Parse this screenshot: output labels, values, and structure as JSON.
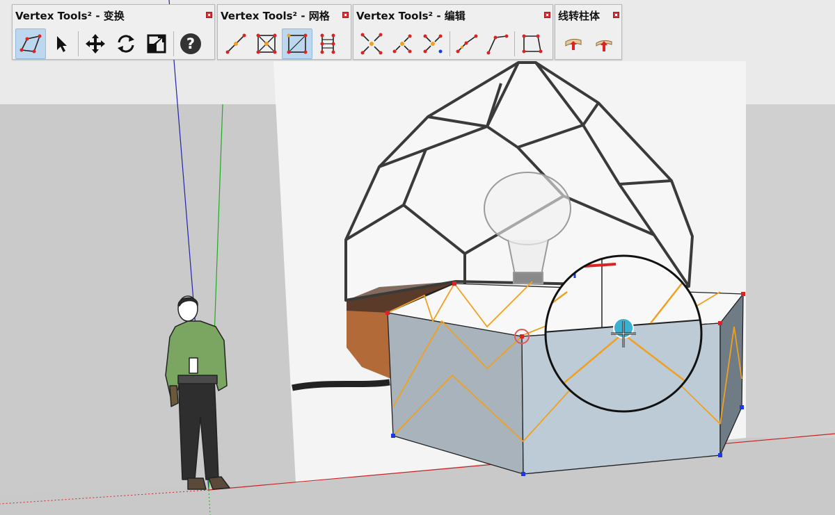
{
  "toolbars": [
    {
      "title": "Vertex Tools² - 变换",
      "tools": [
        "polygon-select-icon",
        "pointer-arrow-icon",
        "move-arrows-icon",
        "rotate-icon",
        "scale-icon",
        "help-icon"
      ]
    },
    {
      "title": "Vertex Tools² - 网格",
      "tools": [
        "line-grid-icon",
        "square-cross-grid-icon",
        "square-corner-grid-icon",
        "ladder-grid-icon"
      ]
    },
    {
      "title": "Vertex Tools² - 编辑",
      "tools": [
        "merge-diagonal-icon",
        "merge-arrows-icon",
        "merge-x-icon",
        "extend-line-icon",
        "corner-line-icon",
        "square-vertex-icon"
      ]
    },
    {
      "title": "线转柱体",
      "tools": [
        "line-to-pipe-icon",
        "line-to-pipe-up-icon"
      ]
    }
  ],
  "active_tools": [
    "polygon-select-icon",
    "square-corner-grid-icon"
  ],
  "colors": {
    "axis_red": "#cc2222",
    "axis_green": "#22aa22",
    "axis_blue": "#2222aa",
    "mesh_face": "#bccbd6",
    "mesh_edge": "#f0a020",
    "vertex_selected": "#dd2222",
    "vertex_unselected": "#1a3ae8",
    "toolbar_active": "#bcd7ee"
  }
}
